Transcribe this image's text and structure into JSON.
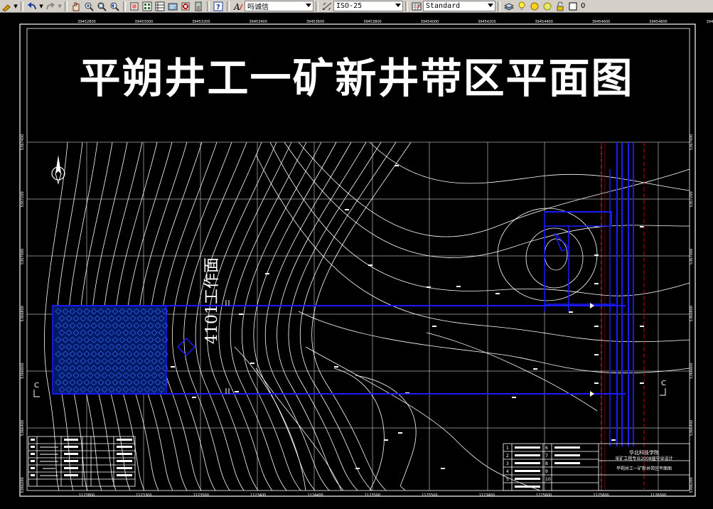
{
  "toolbar": {
    "font_name": "吗诚信",
    "dim_style": "ISO-25",
    "table_style": "Standard",
    "layer_name": "0"
  },
  "drawing": {
    "title": "平朔井工一矿新井带区平面图",
    "working_face_label": "4101工作面",
    "section_left": "C",
    "section_right": "C",
    "school_name": "华北科技学院",
    "course_line": "采矿工程专业2008届毕业设计",
    "drawing_name": "平朔井工一矿新井带区平面图",
    "top_ticks": [
      "39452800",
      "39453000",
      "39453200",
      "39453400",
      "39453600",
      "39453800",
      "39454000",
      "39454200",
      "39454400",
      "39454600",
      "39454800",
      "39455000"
    ],
    "bottom_ticks": [
      "1123800",
      "1123300",
      "1123500",
      "1123400",
      "1124400",
      "1123500",
      "1125500",
      "1123400",
      "1125600",
      "1125800",
      "1126000"
    ],
    "left_ticks": [
      "5367400",
      "5367200",
      "5367000",
      "5366800",
      "5366600",
      "5366400",
      "5366200"
    ],
    "right_ticks": [
      "5367400",
      "5367200",
      "5367000",
      "5366800",
      "5366600",
      "5366400",
      "5366200"
    ],
    "tb_left_items": [
      "1",
      "2",
      "3",
      "4",
      "5"
    ],
    "tb_right_items": [
      "6",
      "7",
      "8",
      "9",
      "10"
    ]
  },
  "colors": {
    "lines": "#ffffff",
    "roadway": "#1a1aff",
    "fault": "#cc0000",
    "toolbar": "#d4d0c8"
  }
}
